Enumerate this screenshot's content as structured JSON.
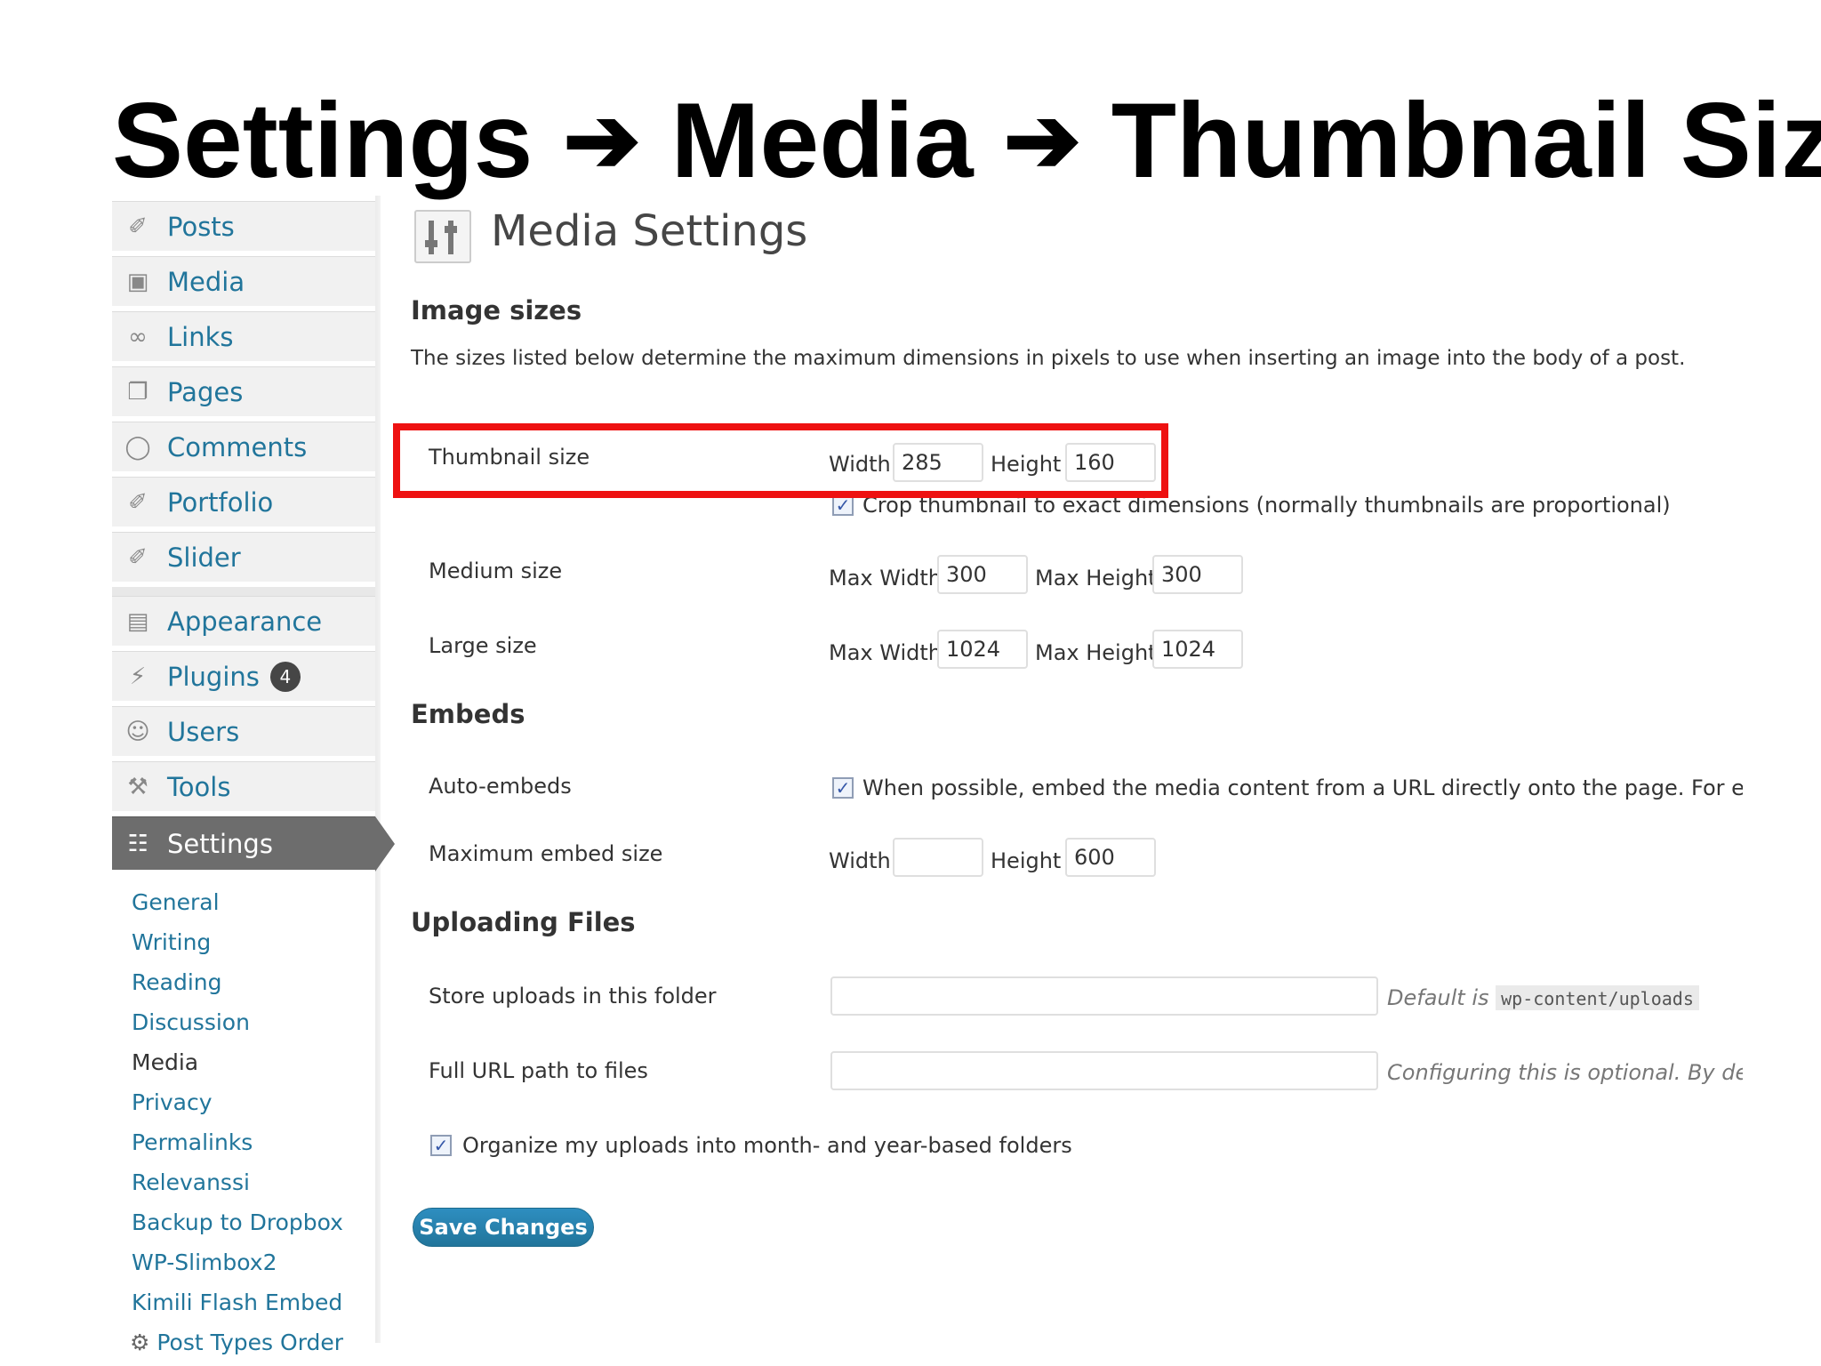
{
  "slide": {
    "title_parts": [
      "Settings",
      "Media",
      "Thumbnail Size"
    ],
    "arrow": "➔"
  },
  "sidebar": {
    "items": [
      {
        "label": "Posts",
        "icon": "pushpin-icon"
      },
      {
        "label": "Media",
        "icon": "media-icon"
      },
      {
        "label": "Links",
        "icon": "link-icon"
      },
      {
        "label": "Pages",
        "icon": "pages-icon"
      },
      {
        "label": "Comments",
        "icon": "comment-icon"
      },
      {
        "label": "Portfolio",
        "icon": "pushpin-icon"
      },
      {
        "label": "Slider",
        "icon": "pushpin-icon"
      },
      {
        "label": "Appearance",
        "icon": "appearance-icon"
      },
      {
        "label": "Plugins",
        "icon": "plugin-icon",
        "badge": "4"
      },
      {
        "label": "Users",
        "icon": "users-icon"
      },
      {
        "label": "Tools",
        "icon": "tools-icon"
      },
      {
        "label": "Settings",
        "icon": "settings-icon",
        "active": true
      }
    ],
    "submenu": [
      "General",
      "Writing",
      "Reading",
      "Discussion",
      "Media",
      "Privacy",
      "Permalinks",
      "Relevanssi",
      "Backup to Dropbox",
      "WP-Slimbox2",
      "Kimili Flash Embed",
      "Post Types Order"
    ],
    "submenu_current": "Media"
  },
  "main": {
    "page_title": "Media Settings",
    "image_sizes": {
      "heading": "Image sizes",
      "description": "The sizes listed below determine the maximum dimensions in pixels to use when inserting an image into the body of a post.",
      "thumbnail": {
        "label": "Thumbnail size",
        "width_label": "Width",
        "width_value": "285",
        "height_label": "Height",
        "height_value": "160",
        "crop_label": "Crop thumbnail to exact dimensions (normally thumbnails are proportional)",
        "crop_checked": true
      },
      "medium": {
        "label": "Medium size",
        "max_width_label": "Max Width",
        "max_width_value": "300",
        "max_height_label": "Max Height",
        "max_height_value": "300"
      },
      "large": {
        "label": "Large size",
        "max_width_label": "Max Width",
        "max_width_value": "1024",
        "max_height_label": "Max Height",
        "max_height_value": "1024"
      }
    },
    "embeds": {
      "heading": "Embeds",
      "auto_label": "Auto-embeds",
      "auto_text": "When possible, embed the media content from a URL directly onto the page. For exampl",
      "auto_checked": true,
      "max_label": "Maximum embed size",
      "width_label": "Width",
      "width_value": "",
      "height_label": "Height",
      "height_value": "600"
    },
    "uploading": {
      "heading": "Uploading Files",
      "store_label": "Store uploads in this folder",
      "store_value": "",
      "store_hint_prefix": "Default is",
      "store_hint_code": "wp-content/uploads",
      "url_label": "Full URL path to files",
      "url_value": "",
      "url_hint": "Configuring this is optional. By defau",
      "organize_label": "Organize my uploads into month- and year-based folders",
      "organize_checked": true
    },
    "save_label": "Save Changes"
  },
  "colors": {
    "link": "#21759b",
    "active_menu_bg": "#6d6d6d",
    "highlight": "#ee1111",
    "button": "#21759b"
  }
}
